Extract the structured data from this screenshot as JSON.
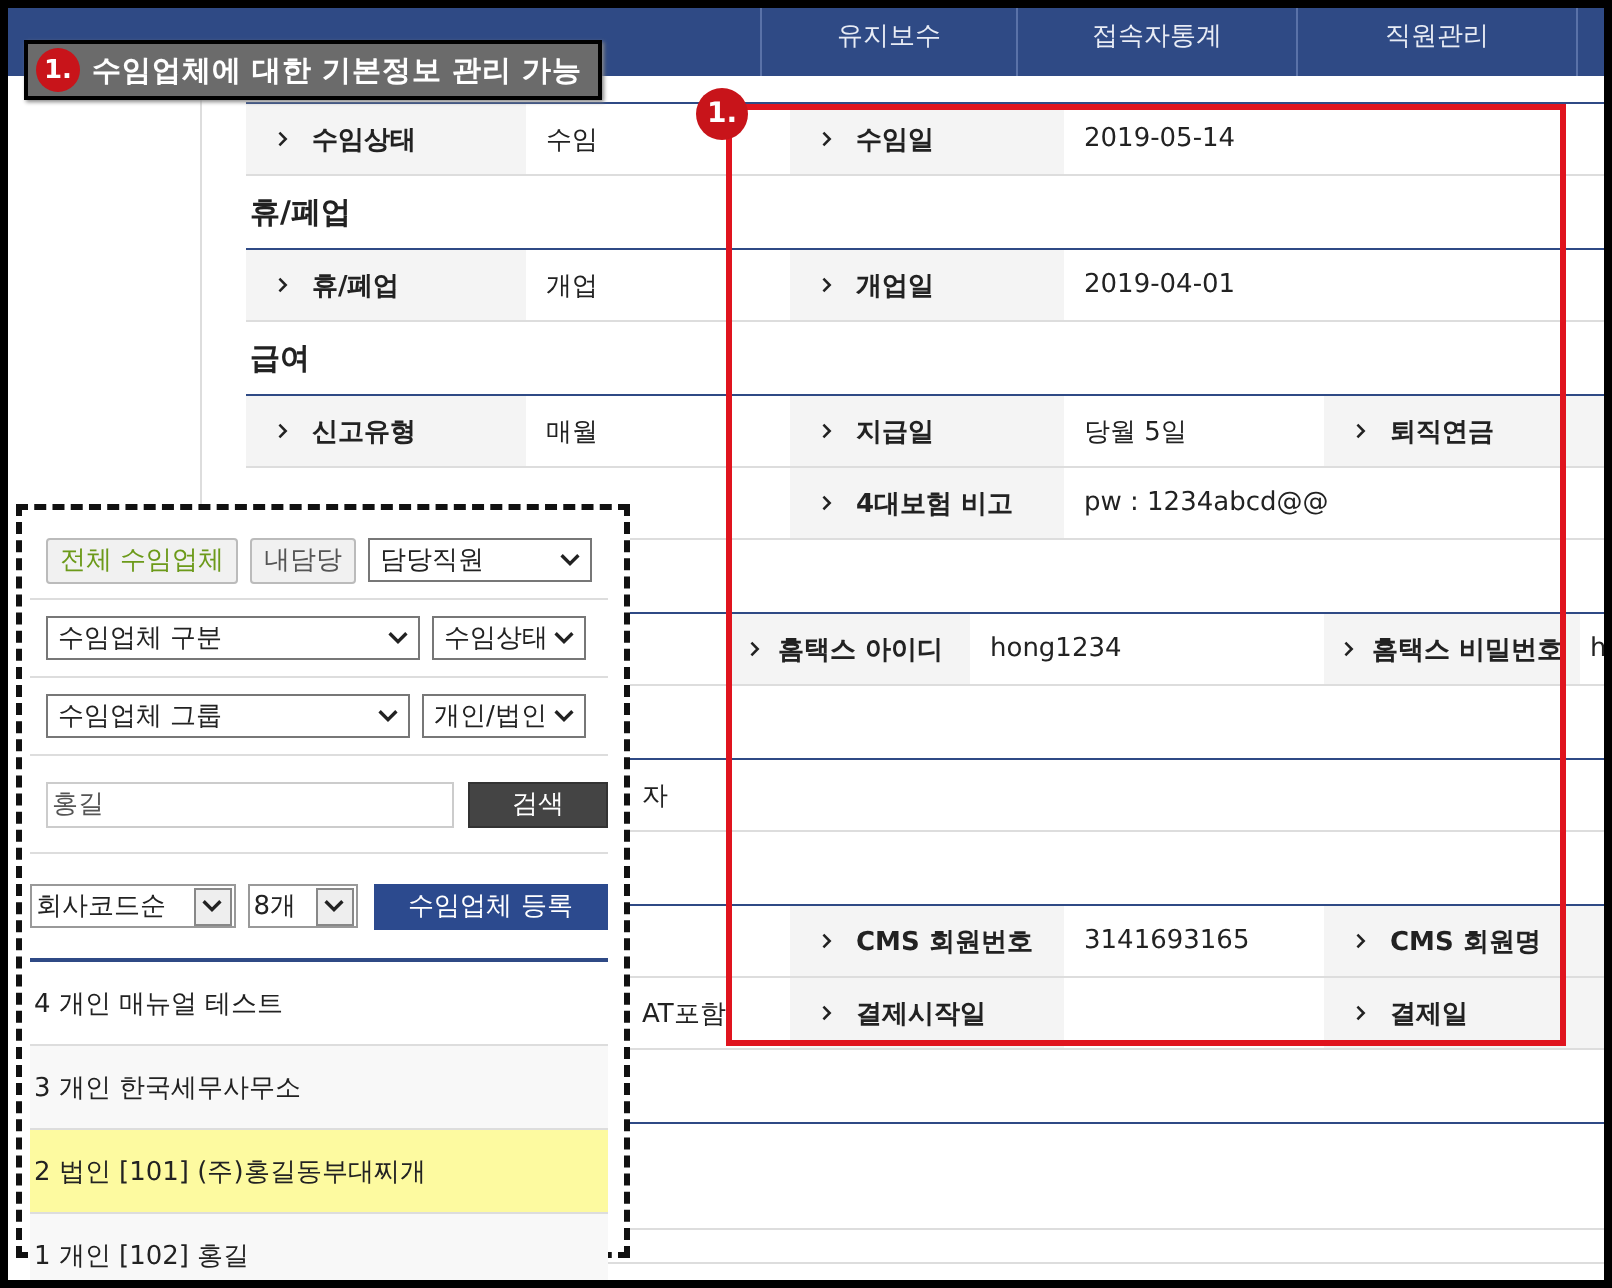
{
  "nav": {
    "tabs": [
      {
        "label": "유지보수"
      },
      {
        "label": "접속자통계"
      },
      {
        "label": "직원관리"
      }
    ]
  },
  "callout": {
    "number": "1.",
    "text": "수임업체에 대한 기본정보 관리 가능"
  },
  "highlight": {
    "number": "1."
  },
  "blocks": [
    {
      "rows": [
        {
          "kind": "normal",
          "cells": [
            {
              "kind": "label",
              "text": "수임상태"
            },
            {
              "kind": "value",
              "text": "수임"
            },
            {
              "kind": "label",
              "text": "수임일"
            },
            {
              "kind": "value",
              "text": "2019-05-14"
            }
          ]
        }
      ]
    },
    {
      "heading": "휴/폐업",
      "rows": [
        {
          "kind": "normal",
          "cells": [
            {
              "kind": "label",
              "text": "휴/폐업"
            },
            {
              "kind": "value",
              "text": "개업"
            },
            {
              "kind": "label",
              "text": "개업일"
            },
            {
              "kind": "value",
              "text": "2019-04-01"
            }
          ]
        }
      ]
    },
    {
      "heading": "급여",
      "rows": [
        {
          "kind": "normal",
          "cells": [
            {
              "kind": "label",
              "text": "신고유형"
            },
            {
              "kind": "value",
              "text": "매월"
            },
            {
              "kind": "label",
              "text": "지급일"
            },
            {
              "kind": "value",
              "text": "당월 5일"
            },
            {
              "kind": "label",
              "text": "퇴직연금"
            }
          ]
        },
        {
          "kind": "normal",
          "cells": [
            {
              "kind": "empty"
            },
            {
              "kind": "empty"
            },
            {
              "kind": "label",
              "text": "4대보험 비고"
            },
            {
              "kind": "value",
              "text": "pw : 1234abcd@@"
            }
          ]
        }
      ]
    },
    {
      "rows": [
        {
          "kind": "shifted",
          "cells": [
            {
              "kind": "label",
              "text": "홈택스 아이디"
            },
            {
              "kind": "value",
              "text": "hong1234"
            },
            {
              "kind": "label",
              "text": "홈택스 비밀번호"
            },
            {
              "kind": "value",
              "text": "h"
            }
          ]
        }
      ]
    },
    {
      "rows": [
        {
          "kind": "covered",
          "cells": [
            {
              "kind": "empty"
            },
            {
              "kind": "value",
              "text": "자"
            }
          ]
        }
      ]
    },
    {
      "rows": [
        {
          "kind": "normal",
          "cells": [
            {
              "kind": "empty"
            },
            {
              "kind": "empty"
            },
            {
              "kind": "label",
              "text": "CMS 회원번호"
            },
            {
              "kind": "value",
              "text": "3141693165"
            },
            {
              "kind": "label",
              "text": "CMS 회원명"
            }
          ]
        },
        {
          "kind": "covered",
          "cells": [
            {
              "kind": "empty"
            },
            {
              "kind": "value",
              "text": "AT포함"
            },
            {
              "kind": "label",
              "text": "결제시작일"
            },
            {
              "kind": "empty"
            },
            {
              "kind": "label",
              "text": "결제일"
            }
          ]
        }
      ]
    }
  ],
  "panel": {
    "all_button": "전체 수임업체",
    "mine_button": "내담당",
    "staff_select": "담당직원",
    "type_select": "수임업체 구분",
    "status_select": "수임상태",
    "group_select": "수임업체 그룹",
    "entity_select": "개인/법인",
    "search": {
      "value": "홍길",
      "button": "검색"
    },
    "sort_select": "회사코드순",
    "count_select": "8개",
    "register_button": "수임업체 등록",
    "clients": [
      {
        "text": "4 개인 매뉴얼 테스트",
        "selected": false
      },
      {
        "text": "3 개인 한국세무사무소",
        "selected": false
      },
      {
        "text": "2 법인 [101] (주)홍길동부대찌개",
        "selected": true
      },
      {
        "text": "1 개인 [102] 홍길",
        "selected": false
      }
    ]
  }
}
